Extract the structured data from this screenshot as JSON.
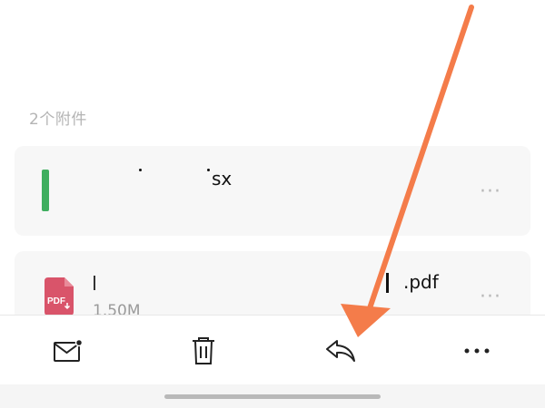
{
  "attachments": {
    "header": "2个附件",
    "items": [
      {
        "name": "sx",
        "type_icon": "xlsx-icon",
        "more": "···"
      },
      {
        "name": ".pdf",
        "size": "1.50M",
        "type_icon": "pdf-icon",
        "type_label": "PDF",
        "more": "···"
      }
    ]
  },
  "toolbar": {
    "icons": [
      "mail-unread-icon",
      "trash-icon",
      "reply-icon",
      "more-horizontal-icon"
    ],
    "more_label": "···"
  },
  "annotation": {
    "arrow_color": "#f47c4a"
  },
  "colors": {
    "xlsx": "#3fae5f",
    "pdf": "#d9546a",
    "card_bg": "#f7f7f7",
    "section_label": "#b4b4b4"
  }
}
